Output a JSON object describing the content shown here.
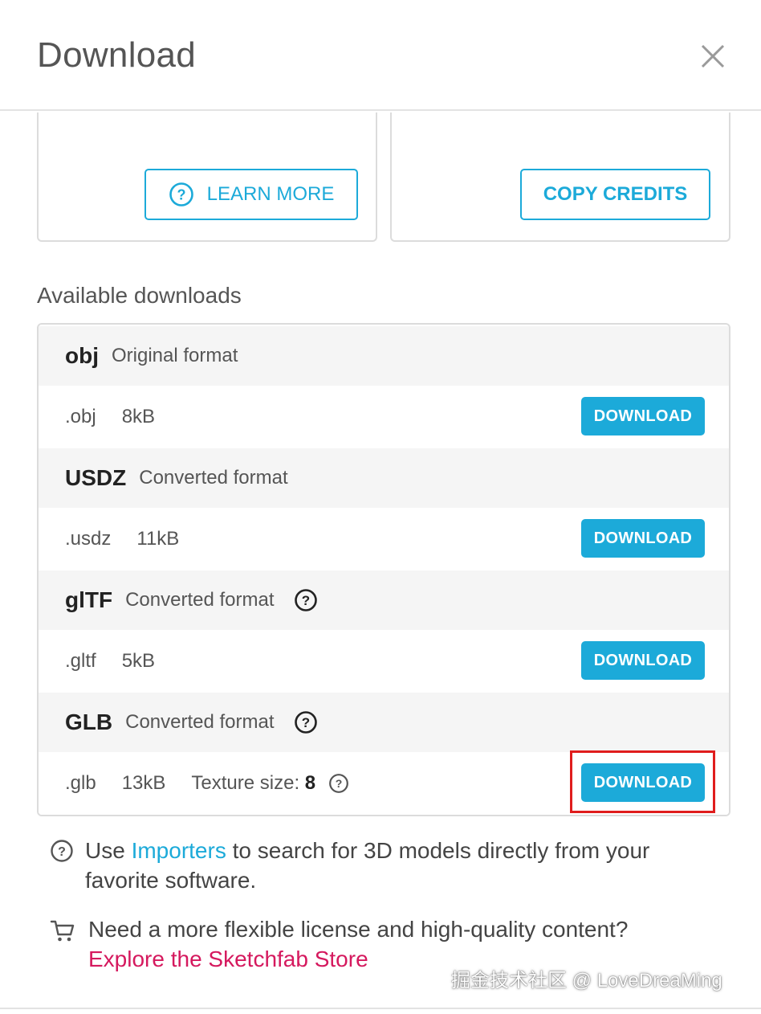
{
  "dialog": {
    "title": "Download",
    "close_icon": "close-icon"
  },
  "cards": {
    "learn_more_label": "LEARN MORE",
    "learn_more_icon": "question-circle-icon",
    "copy_credits_label": "COPY CREDITS"
  },
  "downloads": {
    "section_title": "Available downloads",
    "formats": [
      {
        "name": "obj",
        "type": "Original format",
        "ext": ".obj",
        "size": "8kB",
        "button": "DOWNLOAD"
      },
      {
        "name": "USDZ",
        "type": "Converted format",
        "ext": ".usdz",
        "size": "11kB",
        "button": "DOWNLOAD"
      },
      {
        "name": "glTF",
        "type": "Converted format",
        "ext": ".gltf",
        "size": "5kB",
        "button": "DOWNLOAD",
        "help_icon": "question-circle-icon"
      },
      {
        "name": "GLB",
        "type": "Converted format",
        "ext": ".glb",
        "size": "13kB",
        "button": "DOWNLOAD",
        "help_icon": "question-circle-icon",
        "texture_label": "Texture size:",
        "texture_value": "8"
      }
    ]
  },
  "tips": {
    "importers_prefix": "Use",
    "importers_link": "Importers",
    "importers_suffix": "to search for 3D models directly from your favorite software.",
    "store_text": "Need a more flexible license and high-quality content?",
    "store_link": "Explore the Sketchfab Store",
    "cart_icon": "cart-icon"
  },
  "watermark": "掘金技术社区 @ LoveDreaMing",
  "colors": {
    "accent": "#1caad9",
    "store_link": "#d5195e",
    "highlight": "#e01d1d"
  }
}
